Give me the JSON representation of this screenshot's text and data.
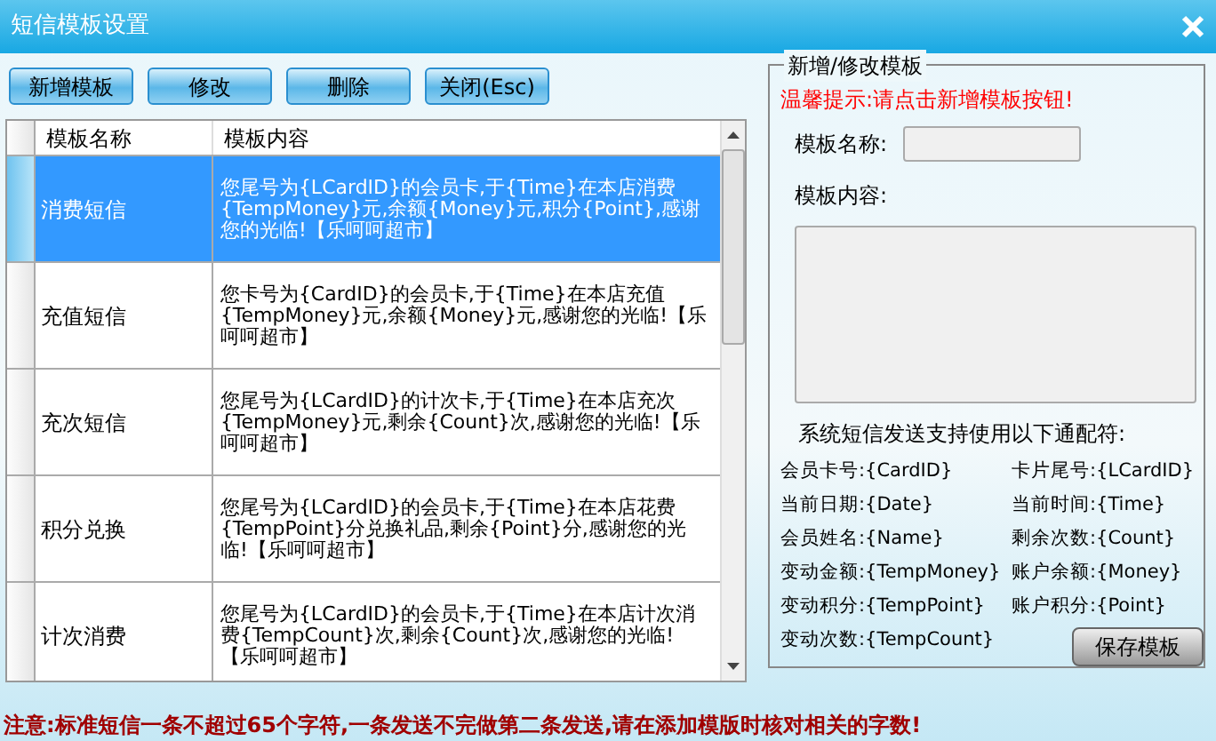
{
  "window": {
    "title": "短信模板设置"
  },
  "toolbar": [
    "新增模板",
    "修改",
    "删除",
    "关闭(Esc)"
  ],
  "table": {
    "columns": [
      "模板名称",
      "模板内容"
    ],
    "rows": [
      {
        "name": "消费短信",
        "content": "您尾号为{LCardID}的会员卡,于{Time}在本店消费{TempMoney}元,余额{Money}元,积分{Point},感谢您的光临!【乐呵呵超市】",
        "selected": true
      },
      {
        "name": "充值短信",
        "content": "您卡号为{CardID}的会员卡,于{Time}在本店充值{TempMoney}元,余额{Money}元,感谢您的光临!【乐呵呵超市】",
        "selected": false
      },
      {
        "name": "充次短信",
        "content": "您尾号为{LCardID}的计次卡,于{Time}在本店充次{TempMoney}元,剩余{Count}次,感谢您的光临!【乐呵呵超市】",
        "selected": false
      },
      {
        "name": "积分兑换",
        "content": "您尾号为{LCardID}的会员卡,于{Time}在本店花费{TempPoint}分兑换礼品,剩余{Point}分,感谢您的光临!【乐呵呵超市】",
        "selected": false
      },
      {
        "name": "计次消费",
        "content": "您尾号为{LCardID}的会员卡,于{Time}在本店计次消费{TempCount}次,剩余{Count}次,感谢您的光临!【乐呵呵超市】",
        "selected": false
      }
    ]
  },
  "editor": {
    "legend": "新增/修改模板",
    "hint": "温馨提示:请点击新增模板按钮!",
    "name_label": "模板名称:",
    "content_label": "模板内容:",
    "wildcards_heading": "系统短信发送支持使用以下通配符:",
    "wildcards": [
      "会员卡号:{CardID}",
      "卡片尾号:{LCardID}",
      "当前日期:{Date}",
      "当前时间:{Time}",
      "会员姓名:{Name}",
      "剩余次数:{Count}",
      "变动金额:{TempMoney}",
      "账户余额:{Money}",
      "变动积分:{TempPoint}",
      "账户积分:{Point}",
      "变动次数:{TempCount}"
    ],
    "save_button": "保存模板"
  },
  "footer_note": "注意:标准短信一条不超过65个字符,一条发送不完做第二条发送,请在添加模版时核对相关的字数!"
}
